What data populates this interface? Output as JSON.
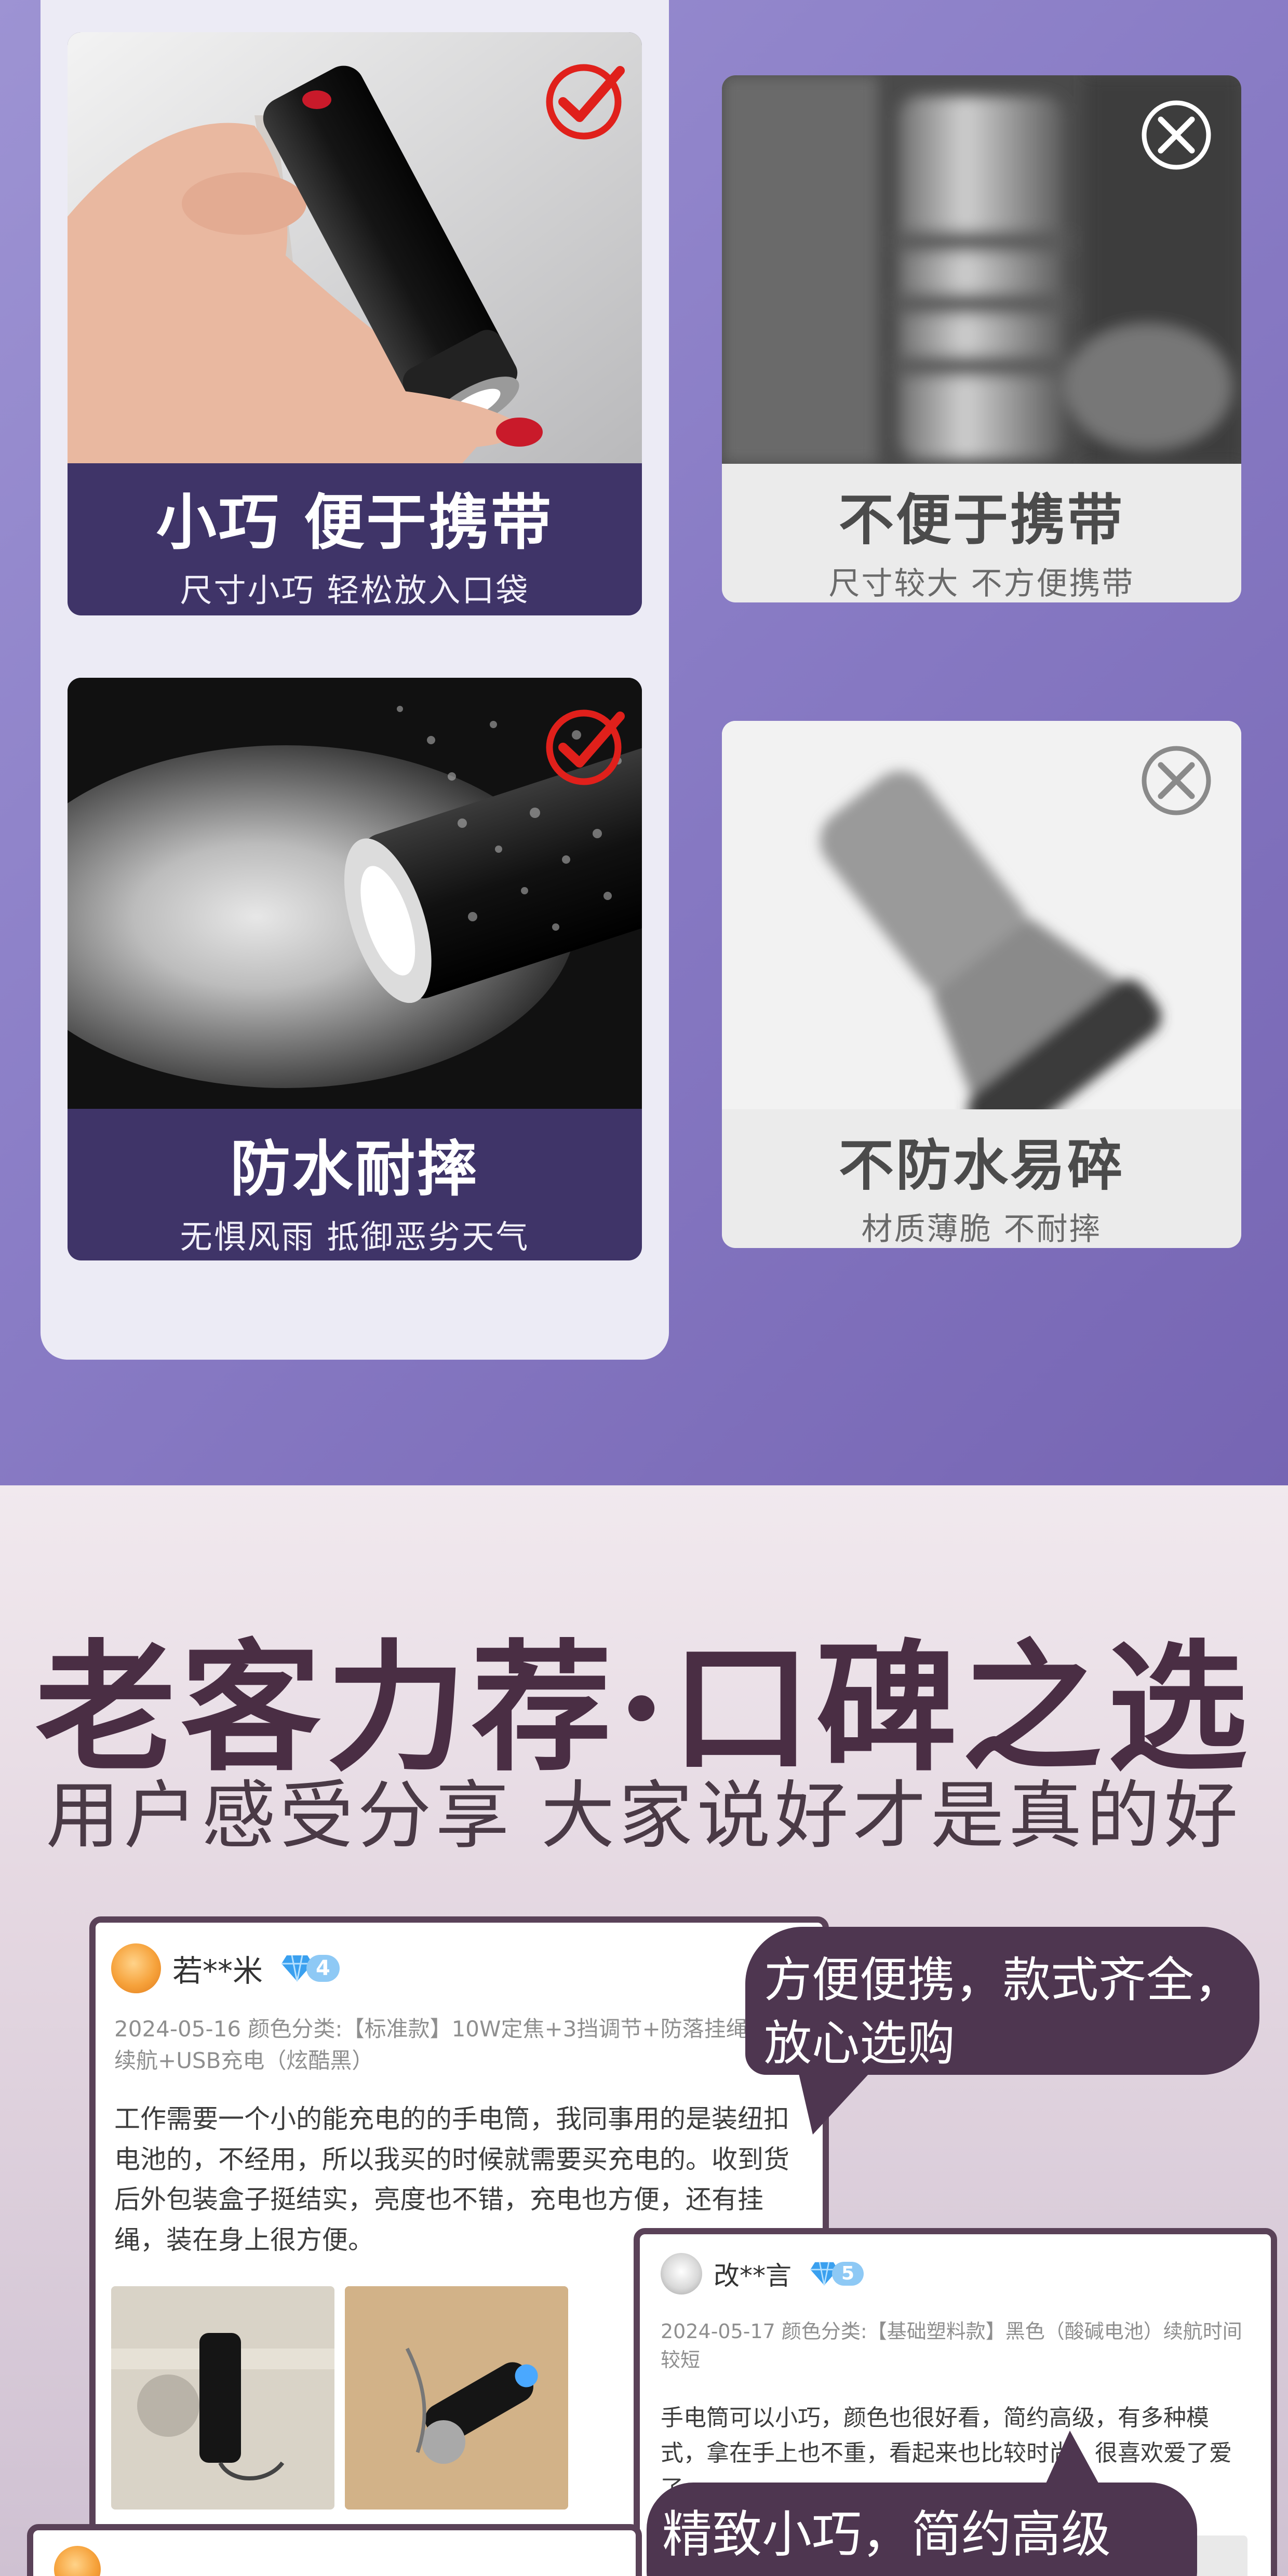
{
  "comparison": {
    "good_cards": [
      {
        "title": "小巧 便于携带",
        "subtitle": "尺寸小巧 轻松放入口袋",
        "status_icon": "check-icon"
      },
      {
        "title": "防水耐摔",
        "subtitle": "无惧风雨 抵御恶劣天气",
        "status_icon": "check-icon"
      }
    ],
    "bad_cards": [
      {
        "title": "不便于携带",
        "subtitle": "尺寸较大 不方便携带",
        "status_icon": "x-icon"
      },
      {
        "title": "不防水易碎",
        "subtitle": "材质薄脆 不耐摔",
        "status_icon": "x-icon"
      }
    ]
  },
  "testimonials": {
    "headline": "老客力荐·口碑之选",
    "subheadline": "用户感受分享 大家说好才是真的好",
    "reviews": [
      {
        "user": "若**米",
        "level": "4",
        "meta": "2024-05-16 颜色分类:【标准款】10W定焦+3挡调节+防落挂绳+长续航+USB充电（炫酷黑）",
        "text": "工作需要一个小的能充电的的手电筒，我同事用的是装纽扣电池的，不经用，所以我买的时候就需要买充电的。收到货后外包装盒子挺结实，亮度也不错，充电也方便，还有挂绳，装在身上很方便。"
      },
      {
        "user": "改**言",
        "level": "5",
        "meta": "2024-05-17 颜色分类:【基础塑料款】黑色（酸碱电池）续航时间较短",
        "text": "手电筒可以小巧，颜色也很好看，简约高级，有多种模式，拿在手上也不重，看起来也比较时尚，很喜欢爱了爱了…………"
      }
    ],
    "bubbles": [
      {
        "text_line1": "方便便携，款式齐全，",
        "text_line2": "放心选购"
      },
      {
        "text_line1": "精致小巧，简约高级"
      }
    ]
  },
  "colors": {
    "brand_purple": "#3f3468",
    "headline_color": "#4a2e44",
    "check_red": "#e0201b"
  }
}
